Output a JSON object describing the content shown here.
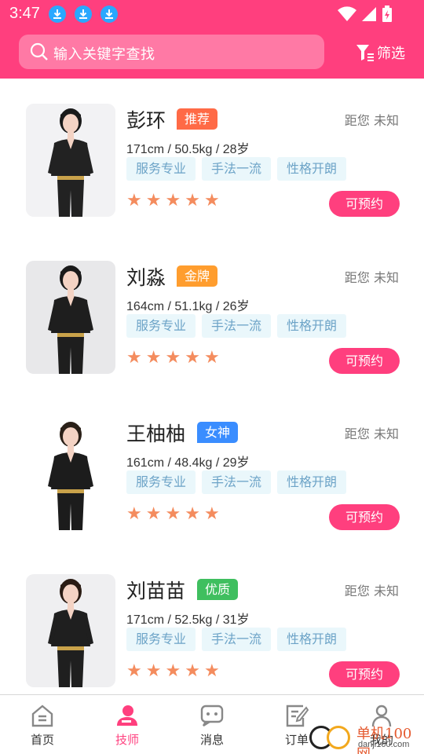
{
  "status_bar": {
    "time": "3:47"
  },
  "header": {
    "search_placeholder": "输入关键字查找",
    "filter_label": "筛选",
    "brand_color": "#ff3f7e"
  },
  "technicians": [
    {
      "name": "彭环",
      "badge": "推荐",
      "badge_color": "#ff6a46",
      "stats": "171cm / 50.5kg / 28岁",
      "distance": "距您 未知",
      "tags": [
        "服务专业",
        "手法一流",
        "性格开朗"
      ],
      "rating": 5,
      "book_label": "可预约"
    },
    {
      "name": "刘淼",
      "badge": "金牌",
      "badge_color": "#ff9d2e",
      "stats": "164cm / 51.1kg / 26岁",
      "distance": "距您 未知",
      "tags": [
        "服务专业",
        "手法一流",
        "性格开朗"
      ],
      "rating": 5,
      "book_label": "可预约"
    },
    {
      "name": "王柚柚",
      "badge": "女神",
      "badge_color": "#3a8dff",
      "stats": "161cm / 48.4kg / 29岁",
      "distance": "距您 未知",
      "tags": [
        "服务专业",
        "手法一流",
        "性格开朗"
      ],
      "rating": 5,
      "book_label": "可预约"
    },
    {
      "name": "刘苗苗",
      "badge": "优质",
      "badge_color": "#3fbf5f",
      "stats": "171cm / 52.5kg / 31岁",
      "distance": "距您 未知",
      "tags": [
        "服务专业",
        "手法一流",
        "性格开朗"
      ],
      "rating": 5,
      "book_label": "可预约"
    }
  ],
  "bottom_nav": {
    "items": [
      {
        "label": "首页",
        "icon": "home-icon"
      },
      {
        "label": "技师",
        "icon": "technician-icon",
        "active": true
      },
      {
        "label": "消息",
        "icon": "message-icon"
      },
      {
        "label": "订单",
        "icon": "order-icon"
      },
      {
        "label": "我的",
        "icon": "profile-icon"
      }
    ]
  },
  "watermark": {
    "title": "单机100网",
    "url": "danji100.com"
  }
}
